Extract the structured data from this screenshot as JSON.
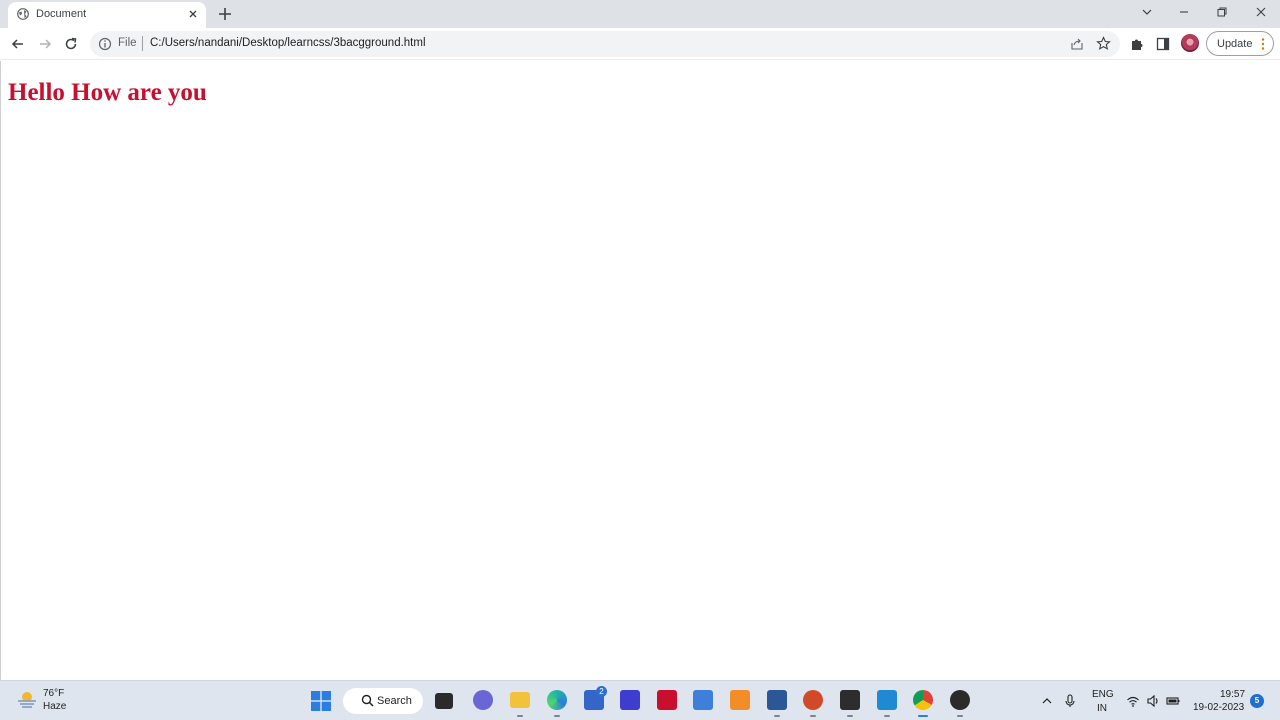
{
  "browser": {
    "tab": {
      "title": "Document"
    },
    "omnibox": {
      "scheme": "File",
      "url": "C:/Users/nandani/Desktop/learncss/3bacgground.html"
    },
    "update_label": "Update"
  },
  "page": {
    "heading": "Hello How are you",
    "heading_color": "#c8102e"
  },
  "taskbar": {
    "weather": {
      "temp": "76°F",
      "condition": "Haze"
    },
    "search_label": "Search",
    "store_badge": "2",
    "language": {
      "line1": "ENG",
      "line2": "IN"
    },
    "clock": {
      "time": "19:57",
      "date": "19-02-2023"
    },
    "notification_count": "5",
    "pinned_apps": [
      "start-icon",
      "file-explorer-task-icon",
      "teams-icon",
      "folder-icon",
      "edge-icon",
      "store-icon",
      "teams-app-icon",
      "mcafee-icon",
      "p-app-icon",
      "xampp-icon",
      "word-icon",
      "powerpoint-icon",
      "terminal-icon",
      "vscode-icon",
      "chrome-icon",
      "obs-icon"
    ]
  }
}
